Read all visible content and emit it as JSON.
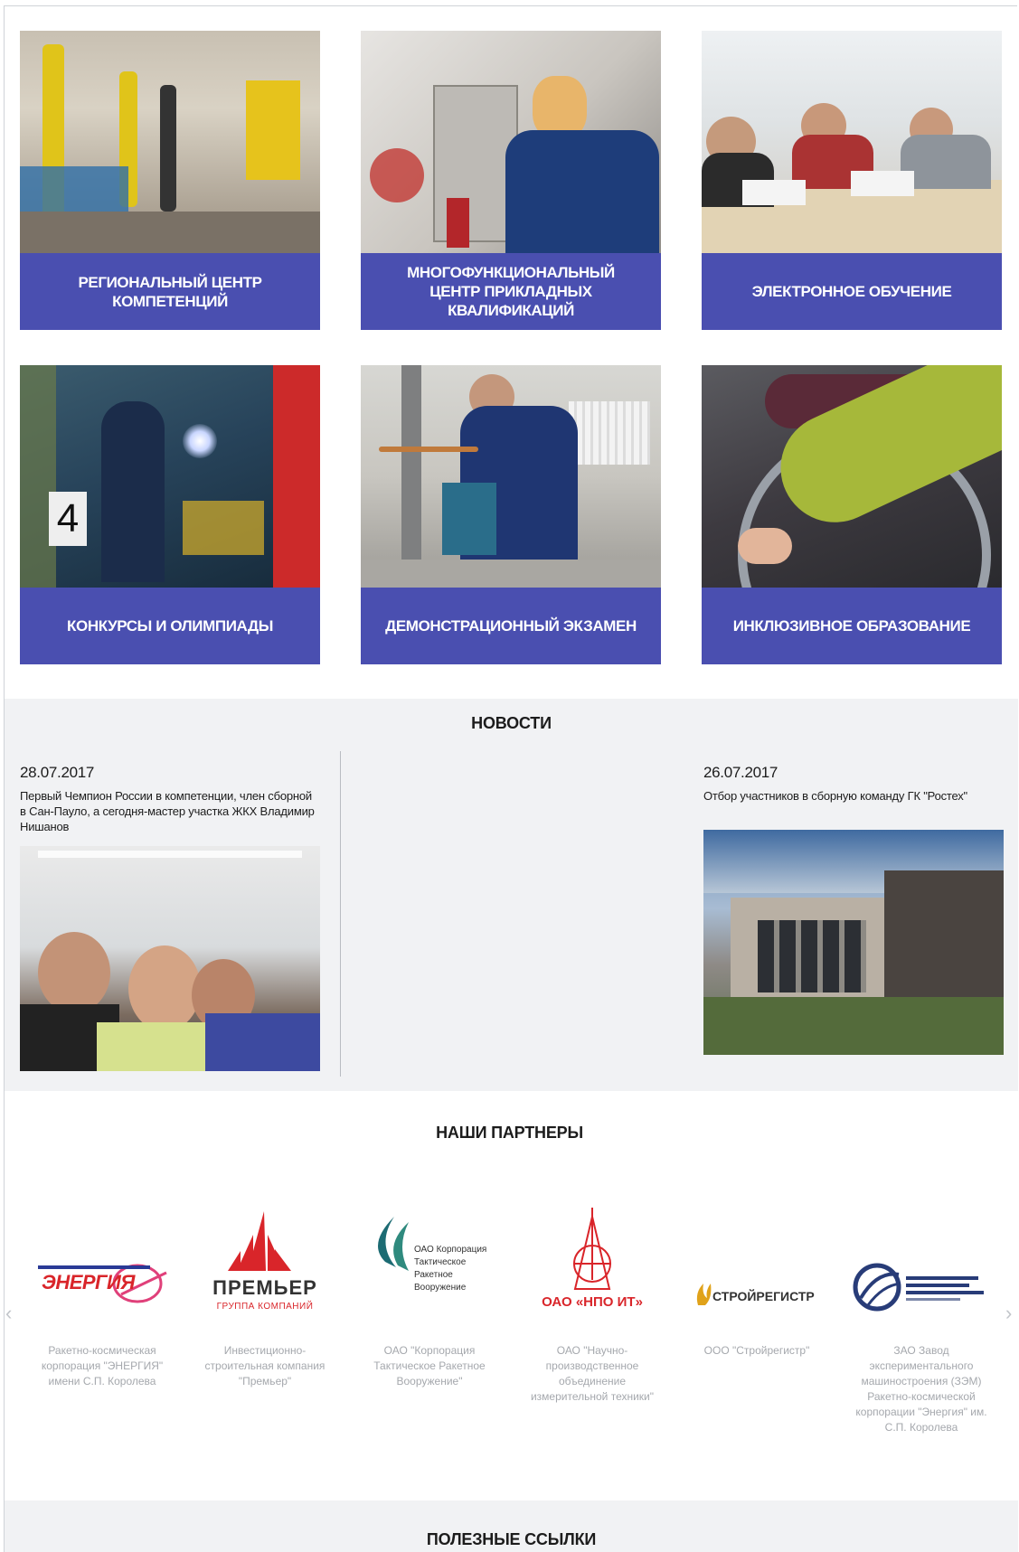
{
  "tiles": [
    {
      "label": "Региональный центр компетенций",
      "icon": "welding-workshop-photo"
    },
    {
      "label": "Многофункциональный центр прикладных квалификаций",
      "icon": "lab-student-photo"
    },
    {
      "label": "Электронное обучение",
      "icon": "classroom-laptops-photo"
    },
    {
      "label": "Конкурсы и олимпиады",
      "icon": "welder-sparks-photo"
    },
    {
      "label": "Демонстрационный экзамен",
      "icon": "pipefitter-photo"
    },
    {
      "label": "Инклюзивное образование",
      "icon": "wheelchair-photo"
    }
  ],
  "news": {
    "title": "НОВОСТИ",
    "items": [
      {
        "date": "28.07.2017",
        "title": "Первый Чемпион России в компетенции, член сборной в Сан-Пауло, а сегодня-мастер участка ЖКХ Владимир Нишанов"
      },
      {
        "date": "26.07.2017",
        "title": "Отбор участников в сборную команду ГК \"Ростех\""
      }
    ]
  },
  "partners": {
    "title": "НАШИ ПАРТНЕРЫ",
    "items": [
      {
        "logo_text": "ЭНЕРГИЯ",
        "logo_subtext": "",
        "caption": "Ракетно-космическая корпорация \"ЭНЕРГИЯ\" имени С.П. Королева"
      },
      {
        "logo_text": "ПРЕМЬЕР",
        "logo_subtext": "ГРУППА КОМПАНИЙ",
        "caption": "Инвестиционно-строительная компания \"Премьер\""
      },
      {
        "logo_text": "ОАО Корпорация Тактическое Ракетное Вооружение",
        "logo_subtext": "",
        "caption": "ОАО \"Корпорация Тактическое Ракетное Вооружение\""
      },
      {
        "logo_text": "ОАО «НПО ИТ»",
        "logo_subtext": "",
        "caption": "ОАО \"Научно-производственное объединение измерительной техники\""
      },
      {
        "logo_text": "СТРОЙРЕГИСТР",
        "logo_subtext": "",
        "caption": "ООО \"Стройрегистр\""
      },
      {
        "logo_text": "",
        "logo_subtext": "",
        "caption": "ЗАО Завод экспериментального машиностроения (ЗЭМ) Ракетно-космической корпорации \"Энергия\" им. С.П. Королева"
      }
    ],
    "prev_icon": "‹",
    "next_icon": "›"
  },
  "links": {
    "title": "ПОЛЕЗНЫЕ ССЫЛКИ"
  },
  "colors": {
    "tile_label_bg": "#4a4fb0",
    "section_bg": "#f1f2f4",
    "caption": "#a5a8ad",
    "logo_red": "#d9252a",
    "logo_teal": "#1c6b73",
    "logo_navy": "#283c78"
  }
}
